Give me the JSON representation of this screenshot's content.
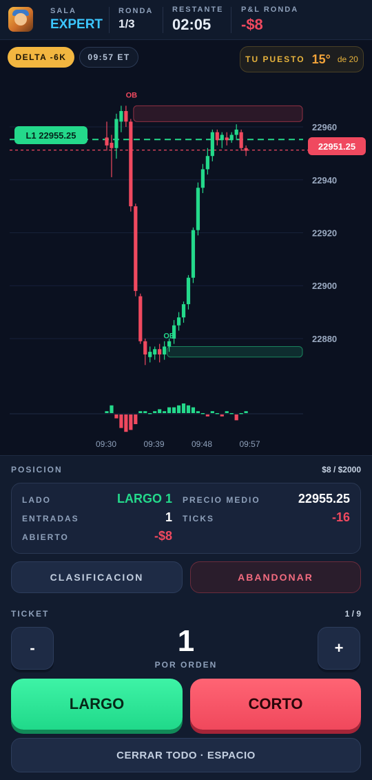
{
  "header": {
    "sala_label": "SALA",
    "sala_value": "EXPERT",
    "ronda_label": "RONDA",
    "ronda_value": "1/3",
    "restante_label": "RESTANTE",
    "restante_value": "02:05",
    "pnl_label": "P&L RONDA",
    "pnl_value": "-$8"
  },
  "chips": {
    "delta": "DELTA -6K",
    "time": "09:57 ET"
  },
  "rank": {
    "label": "TU PUESTO",
    "position": "15°",
    "of": "de 20"
  },
  "chart": {
    "entry_label": "L1 22955.25",
    "current_price": "22951.25",
    "ob_top_label": "OB",
    "ob_bottom_label": "OB",
    "y_ticks": [
      "22960",
      "22940",
      "22920",
      "22900",
      "22880"
    ],
    "x_ticks": [
      "09:30",
      "09:39",
      "09:48",
      "09:57"
    ]
  },
  "chart_data": {
    "type": "candlestick",
    "y_range": [
      22862,
      22972
    ],
    "entry_price": 22955.25,
    "current_price": 22951.25,
    "order_blocks": [
      {
        "label": "OB",
        "low": 22962,
        "high": 22968,
        "from_index": 6,
        "color": "#f0495f"
      },
      {
        "label": "OB",
        "low": 22873,
        "high": 22877,
        "from_index": 13,
        "color": "#24d98b"
      }
    ],
    "candles": [
      {
        "o": 22956,
        "h": 22962,
        "l": 22951,
        "c": 22953
      },
      {
        "o": 22954,
        "h": 22957,
        "l": 22941,
        "c": 22952
      },
      {
        "o": 22952,
        "h": 22965,
        "l": 22948,
        "c": 22963
      },
      {
        "o": 22962,
        "h": 22968,
        "l": 22958,
        "c": 22966
      },
      {
        "o": 22966,
        "h": 22968,
        "l": 22960,
        "c": 22962
      },
      {
        "o": 22962,
        "h": 22963,
        "l": 22928,
        "c": 22930
      },
      {
        "o": 22930,
        "h": 22931,
        "l": 22896,
        "c": 22898
      },
      {
        "o": 22896,
        "h": 22897,
        "l": 22878,
        "c": 22879
      },
      {
        "o": 22879,
        "h": 22880,
        "l": 22870,
        "c": 22874
      },
      {
        "o": 22873,
        "h": 22877,
        "l": 22871,
        "c": 22875
      },
      {
        "o": 22874,
        "h": 22877,
        "l": 22872,
        "c": 22876
      },
      {
        "o": 22876,
        "h": 22878,
        "l": 22871,
        "c": 22874
      },
      {
        "o": 22874,
        "h": 22879,
        "l": 22872,
        "c": 22877
      },
      {
        "o": 22877,
        "h": 22880,
        "l": 22875,
        "c": 22879
      },
      {
        "o": 22880,
        "h": 22887,
        "l": 22878,
        "c": 22885
      },
      {
        "o": 22885,
        "h": 22890,
        "l": 22883,
        "c": 22888
      },
      {
        "o": 22888,
        "h": 22894,
        "l": 22886,
        "c": 22893
      },
      {
        "o": 22893,
        "h": 22904,
        "l": 22891,
        "c": 22903
      },
      {
        "o": 22903,
        "h": 22922,
        "l": 22901,
        "c": 22921
      },
      {
        "o": 22921,
        "h": 22939,
        "l": 22919,
        "c": 22937
      },
      {
        "o": 22937,
        "h": 22946,
        "l": 22935,
        "c": 22944
      },
      {
        "o": 22944,
        "h": 22952,
        "l": 22942,
        "c": 22949
      },
      {
        "o": 22949,
        "h": 22959,
        "l": 22947,
        "c": 22958
      },
      {
        "o": 22958,
        "h": 22959,
        "l": 22953,
        "c": 22955
      },
      {
        "o": 22955,
        "h": 22958,
        "l": 22952,
        "c": 22957
      },
      {
        "o": 22956,
        "h": 22958,
        "l": 22953,
        "c": 22955
      },
      {
        "o": 22955,
        "h": 22958,
        "l": 22954,
        "c": 22957
      },
      {
        "o": 22957,
        "h": 22961,
        "l": 22955,
        "c": 22959
      },
      {
        "o": 22958,
        "h": 22959,
        "l": 22951,
        "c": 22952
      },
      {
        "o": 22952,
        "h": 22953,
        "l": 22949,
        "c": 22951
      }
    ],
    "volume_delta": [
      1,
      4,
      -2,
      -7,
      -9,
      -8,
      -5,
      1,
      1,
      0,
      1,
      2,
      1,
      3,
      3,
      4,
      5,
      4,
      3,
      1,
      0,
      -1,
      1,
      0,
      -1,
      1,
      0,
      -3,
      0,
      1
    ],
    "colors": {
      "up": "#24d98b",
      "down": "#f0495f"
    }
  },
  "position": {
    "title": "POSICION",
    "balance": "$8 / $2000",
    "lado_label": "LADO",
    "lado_value": "LARGO 1",
    "precio_label": "PRECIO MEDIO",
    "precio_value": "22955.25",
    "entradas_label": "ENTRADAS",
    "entradas_value": "1",
    "ticks_label": "TICKS",
    "ticks_value": "-16",
    "abierto_label": "ABIERTO",
    "abierto_value": "-$8"
  },
  "actions": {
    "clasificacion": "CLASIFICACION",
    "abandonar": "ABANDONAR"
  },
  "ticket": {
    "label": "TICKET",
    "count": "1 / 9",
    "minus": "-",
    "plus": "+",
    "quantity": "1",
    "sub_label": "POR ORDEN"
  },
  "trade": {
    "long": "LARGO",
    "short": "CORTO",
    "close_all": "CERRAR TODO · ESPACIO"
  }
}
